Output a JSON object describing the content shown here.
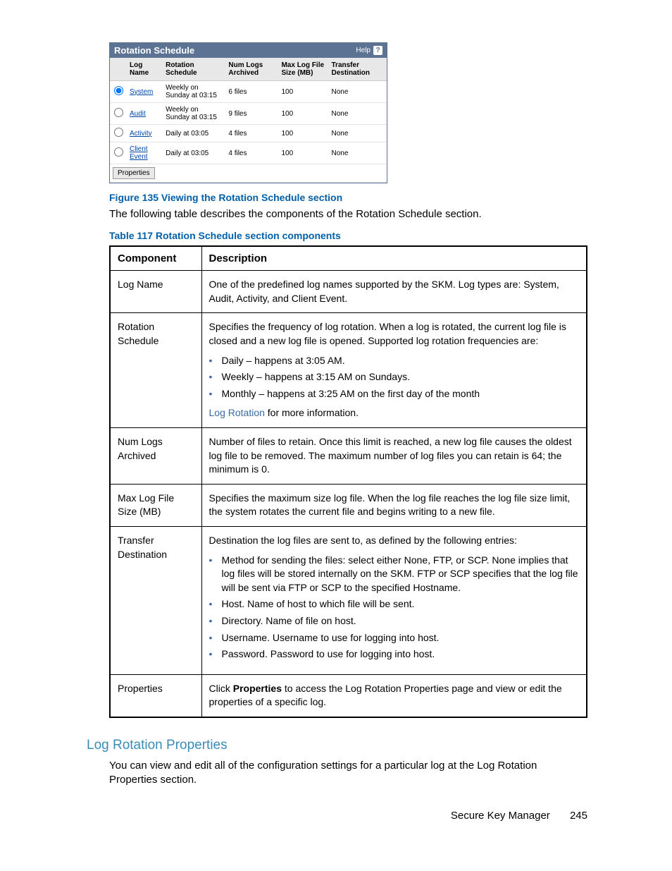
{
  "rs": {
    "title": "Rotation Schedule",
    "help_label": "Help",
    "help_icon": "?",
    "cols": {
      "radio": "",
      "logname": "Log Name",
      "rotation": "Rotation Schedule",
      "numlogs": "Num Logs Archived",
      "maxsize": "Max Log File Size (MB)",
      "transfer": "Transfer Destination"
    },
    "rows": [
      {
        "logname": "System",
        "rotation": "Weekly on Sunday at 03:15",
        "numlogs": "6 files",
        "maxsize": "100",
        "transfer": "None",
        "selected": true
      },
      {
        "logname": "Audit",
        "rotation": "Weekly on Sunday at 03:15",
        "numlogs": "9 files",
        "maxsize": "100",
        "transfer": "None",
        "selected": false
      },
      {
        "logname": "Activity",
        "rotation": "Daily at 03:05",
        "numlogs": "4 files",
        "maxsize": "100",
        "transfer": "None",
        "selected": false
      },
      {
        "logname": "Client Event",
        "rotation": "Daily at 03:05",
        "numlogs": "4 files",
        "maxsize": "100",
        "transfer": "None",
        "selected": false
      }
    ],
    "properties_btn": "Properties"
  },
  "fig_caption": "Figure 135 Viewing the Rotation Schedule section",
  "para1": "The following table describes the components of the Rotation Schedule section.",
  "tab_caption": "Table 117 Rotation Schedule section components",
  "desc": {
    "th_component": "Component",
    "th_description": "Description",
    "rows": {
      "logname": {
        "comp": "Log Name",
        "desc": "One of the predefined log names supported by the SKM. Log types are: System, Audit, Activity, and Client Event."
      },
      "rotation": {
        "comp": "Rotation Schedule",
        "intro": "Specifies the frequency of log rotation. When a log is rotated, the current log file is closed and a new log file is opened. Supported log rotation frequencies are:",
        "bul": [
          "Daily – happens at 3:05 AM.",
          "Weekly – happens at 3:15 AM on Sundays.",
          "Monthly – happens at 3:25 AM on the first day of the month"
        ],
        "link": "Log Rotation",
        "link_tail": " for more information."
      },
      "numlogs": {
        "comp": "Num Logs Archived",
        "desc": "Number of files to retain. Once this limit is reached, a new log file causes the oldest log file to be removed. The maximum number of log files you can retain is 64; the minimum is 0."
      },
      "maxsize": {
        "comp": "Max Log File Size (MB)",
        "desc": "Specifies the maximum size log file. When the log file reaches the log file size limit, the system rotates the current file and begins writing to a new file."
      },
      "transfer": {
        "comp": "Transfer Destination",
        "intro": "Destination the log files are sent to, as defined by the following entries:",
        "bul": [
          "Method for sending the files: select either None, FTP, or SCP. None implies that log files will be stored internally on the SKM. FTP or SCP specifies that the log file will be sent via FTP or SCP to the specified Hostname.",
          "Host. Name of host to which file will be sent.",
          "Directory. Name of file on host.",
          "Username. Username to use for logging into host.",
          "Password. Password to use for logging into host."
        ]
      },
      "props": {
        "comp": "Properties",
        "pre": "Click ",
        "bold": "Properties",
        "post": " to access the Log Rotation Properties page and view or edit the properties of a specific log."
      }
    }
  },
  "section_heading": "Log Rotation Properties",
  "para2": "You can view and edit all of the configuration settings for a particular log at the Log Rotation Properties section.",
  "footer": {
    "title": "Secure Key Manager",
    "page": "245"
  }
}
